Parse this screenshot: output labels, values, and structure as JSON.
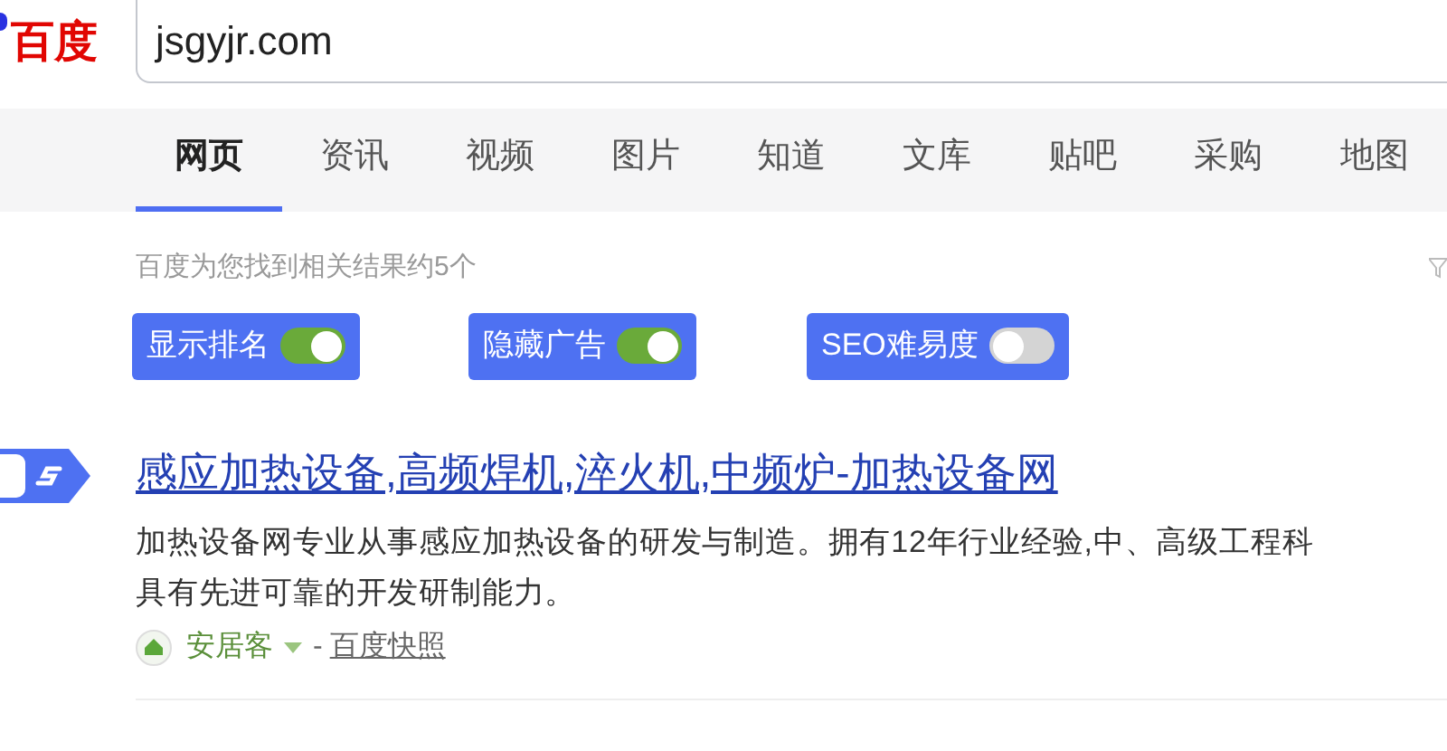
{
  "logo": {
    "text": "百度"
  },
  "search": {
    "value": "jsgyjr.com"
  },
  "tabs": [
    {
      "label": "网页",
      "selected": true
    },
    {
      "label": "资讯",
      "selected": false
    },
    {
      "label": "视频",
      "selected": false
    },
    {
      "label": "图片",
      "selected": false
    },
    {
      "label": "知道",
      "selected": false
    },
    {
      "label": "文库",
      "selected": false
    },
    {
      "label": "贴吧",
      "selected": false
    },
    {
      "label": "采购",
      "selected": false
    },
    {
      "label": "地图",
      "selected": false
    }
  ],
  "result_count": "百度为您找到相关结果约5个",
  "toggles": [
    {
      "label": "显示排名",
      "on": true
    },
    {
      "label": "隐藏广告",
      "on": true
    },
    {
      "label": "SEO难易度",
      "on": false
    }
  ],
  "results": [
    {
      "title": "感应加热设备,高频焊机,淬火机,中频炉-加热设备网",
      "description": [
        "加热设备网专业从事感应加热设备的研发与制造。拥有12年行业经验,中、高级工程科",
        "具有先进可靠的开发研制能力。"
      ],
      "source": "安居客",
      "separator": "-",
      "snapshot": "百度快照"
    }
  ]
}
